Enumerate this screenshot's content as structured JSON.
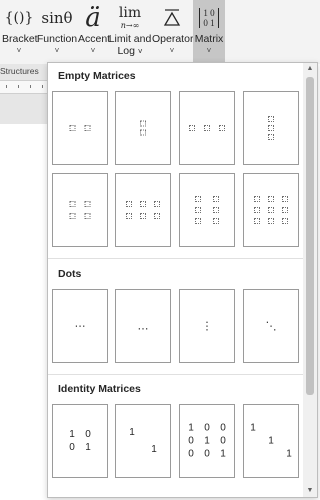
{
  "ribbon": {
    "buttons": [
      {
        "id": "bracket",
        "label": "Bracket",
        "glyph": "{()}",
        "icon": "bracket-icon"
      },
      {
        "id": "function",
        "label": "Function",
        "glyph": "sinθ",
        "icon": "function-icon"
      },
      {
        "id": "accent",
        "label": "Accent",
        "glyph": "ä",
        "icon": "accent-icon"
      },
      {
        "id": "limit",
        "label1": "Limit and",
        "label2": "Log",
        "glyph_top": "lim",
        "glyph_bottom": "n→∞",
        "icon": "limit-icon"
      },
      {
        "id": "operator",
        "label": "Operator",
        "glyph": "∆",
        "icon": "operator-icon"
      },
      {
        "id": "matrix",
        "label": "Matrix",
        "glyph_r1": "1 0",
        "glyph_r2": "0 1",
        "icon": "matrix-icon"
      }
    ],
    "chevron": "˅"
  },
  "doc": {
    "structures_label": "Structures"
  },
  "gallery": {
    "sections": {
      "empty": "Empty Matrices",
      "dots": "Dots",
      "identity": "Identity Matrices"
    },
    "dots": [
      "⋯",
      "…",
      "⋮",
      "⋱"
    ],
    "identity": [
      {
        "cols": 2,
        "cells": [
          "1",
          "0",
          "0",
          "1"
        ]
      },
      {
        "cols": 2,
        "cells": [
          "1",
          "",
          "",
          "1"
        ]
      },
      {
        "cols": 3,
        "cells": [
          "1",
          "0",
          "0",
          "0",
          "1",
          "0",
          "0",
          "0",
          "1"
        ]
      },
      {
        "cols": 3,
        "cells": [
          "1",
          "",
          "",
          "",
          "1",
          "",
          "",
          "",
          "1"
        ]
      }
    ]
  },
  "scrollbar": {
    "up": "▲",
    "down": "▼"
  }
}
